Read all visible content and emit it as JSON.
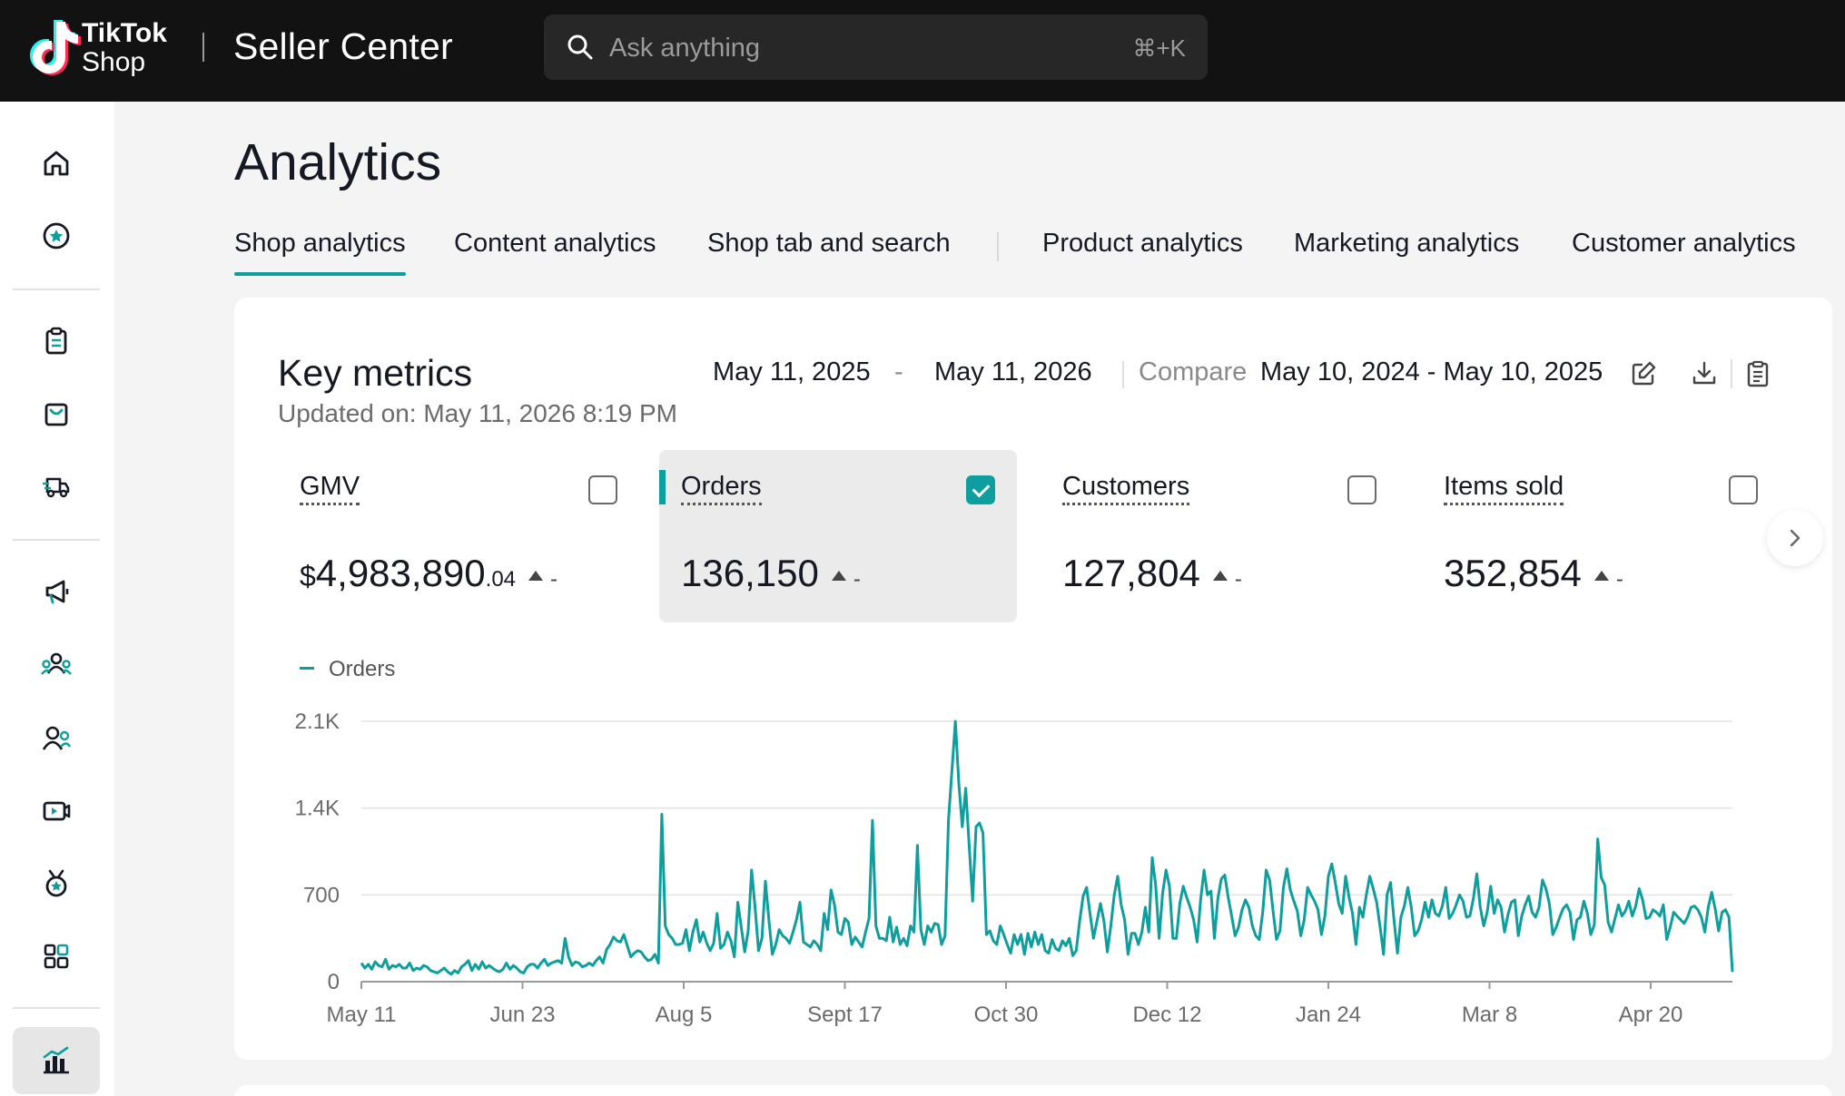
{
  "header": {
    "logo_line1": "TikTok",
    "logo_line2": "Shop",
    "app_title": "Seller Center",
    "search_placeholder": "Ask anything",
    "search_shortcut": "⌘+K"
  },
  "sidebar": {
    "items": [
      {
        "icon": "home-icon"
      },
      {
        "icon": "star-circle-icon"
      },
      {
        "icon": "clipboard-icon"
      },
      {
        "icon": "shopping-bag-icon"
      },
      {
        "icon": "delivery-truck-icon"
      },
      {
        "icon": "megaphone-icon"
      },
      {
        "icon": "creators-icon"
      },
      {
        "icon": "customers-icon"
      },
      {
        "icon": "video-icon"
      },
      {
        "icon": "medal-icon"
      },
      {
        "icon": "apps-grid-icon"
      },
      {
        "icon": "analytics-chart-icon",
        "active": true
      }
    ]
  },
  "page": {
    "title": "Analytics",
    "tabs": [
      {
        "label": "Shop analytics",
        "active": true
      },
      {
        "label": "Content analytics"
      },
      {
        "label": "Shop tab and search"
      },
      {
        "label": "Product analytics"
      },
      {
        "label": "Marketing analytics"
      },
      {
        "label": "Customer analytics"
      }
    ]
  },
  "key_metrics": {
    "title": "Key metrics",
    "updated": "Updated on: May 11, 2026 8:19 PM",
    "date_start": "May 11, 2025",
    "date_dash": "-",
    "date_end": "May 11, 2026",
    "compare_label": "Compare",
    "compare_range": "May 10, 2024 - May 10, 2025",
    "metrics": [
      {
        "name": "GMV",
        "currency": "$",
        "value": "4,983,890",
        "cents": ".04",
        "delta": "-",
        "checked": false
      },
      {
        "name": "Orders",
        "value": "136,150",
        "delta": "-",
        "checked": true
      },
      {
        "name": "Customers",
        "value": "127,804",
        "delta": "-",
        "checked": false
      },
      {
        "name": "Items sold",
        "value": "352,854",
        "delta": "-",
        "checked": false
      }
    ]
  },
  "colors": {
    "accent": "#0e9e9e",
    "topbar": "#121212"
  },
  "chart_data": {
    "type": "line",
    "series": [
      {
        "name": "Orders",
        "values": [
          150,
          110,
          140,
          100,
          160,
          130,
          120,
          180,
          100,
          130,
          120,
          140,
          110,
          110,
          150,
          90,
          110,
          100,
          130,
          120,
          90,
          80,
          70,
          90,
          110,
          80,
          60,
          90,
          70,
          120,
          140,
          170,
          90,
          140,
          100,
          160,
          110,
          130,
          110,
          90,
          80,
          100,
          150,
          100,
          130,
          110,
          80,
          70,
          120,
          140,
          140,
          110,
          150,
          180,
          130,
          150,
          160,
          170,
          150,
          350,
          200,
          130,
          160,
          150,
          120,
          130,
          150,
          130,
          170,
          200,
          150,
          260,
          300,
          360,
          330,
          320,
          380,
          290,
          200,
          230,
          250,
          240,
          200,
          170,
          180,
          220,
          150,
          1350,
          450,
          380,
          350,
          300,
          300,
          310,
          420,
          250,
          400,
          500,
          320,
          400,
          310,
          250,
          310,
          550,
          270,
          300,
          400,
          330,
          200,
          640,
          440,
          240,
          410,
          900,
          600,
          250,
          350,
          810,
          500,
          220,
          300,
          420,
          370,
          350,
          310,
          400,
          500,
          640,
          320,
          300,
          280,
          330,
          300,
          250,
          550,
          420,
          740,
          620,
          400,
          380,
          510,
          480,
          300,
          360,
          320,
          280,
          400,
          510,
          1300,
          450,
          350,
          350,
          330,
          520,
          320,
          440,
          300,
          350,
          290,
          450,
          400,
          1100,
          420,
          300,
          450,
          400,
          470,
          460,
          300,
          370,
          1300,
          1700,
          2100,
          1600,
          1250,
          1560,
          1100,
          650,
          1250,
          1280,
          1200,
          380,
          410,
          330,
          300,
          450,
          380,
          300,
          230,
          380,
          300,
          380,
          220,
          390,
          280,
          400,
          300,
          380,
          250,
          230,
          340,
          270,
          250,
          330,
          290,
          350,
          210,
          250,
          490,
          690,
          760,
          550,
          350,
          490,
          630,
          490,
          240,
          450,
          700,
          850,
          620,
          500,
          220,
          390,
          390,
          300,
          400,
          600,
          400,
          1000,
          780,
          350,
          710,
          900,
          770,
          350,
          350,
          630,
          770,
          680,
          600,
          500,
          320,
          660,
          900,
          700,
          730,
          350,
          670,
          830,
          860,
          680,
          530,
          370,
          440,
          580,
          660,
          600,
          450,
          370,
          340,
          560,
          900,
          820,
          570,
          340,
          410,
          760,
          910,
          740,
          650,
          570,
          370,
          500,
          760,
          700,
          650,
          580,
          380,
          530,
          850,
          950,
          800,
          630,
          550,
          850,
          680,
          550,
          300,
          600,
          520,
          700,
          850,
          750,
          640,
          440,
          220,
          700,
          800,
          500,
          230,
          520,
          610,
          760,
          600,
          370,
          410,
          500,
          640,
          520,
          660,
          550,
          530,
          610,
          760,
          510,
          550,
          620,
          700,
          650,
          520,
          530,
          670,
          870,
          600,
          450,
          560,
          770,
          550,
          660,
          600,
          400,
          540,
          640,
          660,
          370,
          530,
          620,
          690,
          560,
          520,
          600,
          820,
          750,
          630,
          380,
          440,
          520,
          590,
          620,
          560,
          340,
          500,
          520,
          650,
          550,
          380,
          460,
          1150,
          840,
          780,
          480,
          400,
          510,
          620,
          530,
          570,
          650,
          530,
          610,
          750,
          660,
          510,
          520,
          580,
          560,
          530,
          620,
          340,
          440,
          560,
          530,
          500,
          470,
          520,
          600,
          610,
          580,
          520,
          400,
          600,
          720,
          590,
          410,
          560,
          580,
          520,
          80
        ],
        "color": "#0e9e9e"
      }
    ],
    "x_ticks": [
      "May 11",
      "Jun 23",
      "Aug 5",
      "Sept 17",
      "Oct 30",
      "Dec 12",
      "Jan 24",
      "Mar 8",
      "Apr 20"
    ],
    "y_ticks": [
      "0",
      "700",
      "1.4K",
      "2.1K"
    ],
    "ylim": [
      0,
      2100
    ],
    "grid": true,
    "legend": "top-left"
  }
}
